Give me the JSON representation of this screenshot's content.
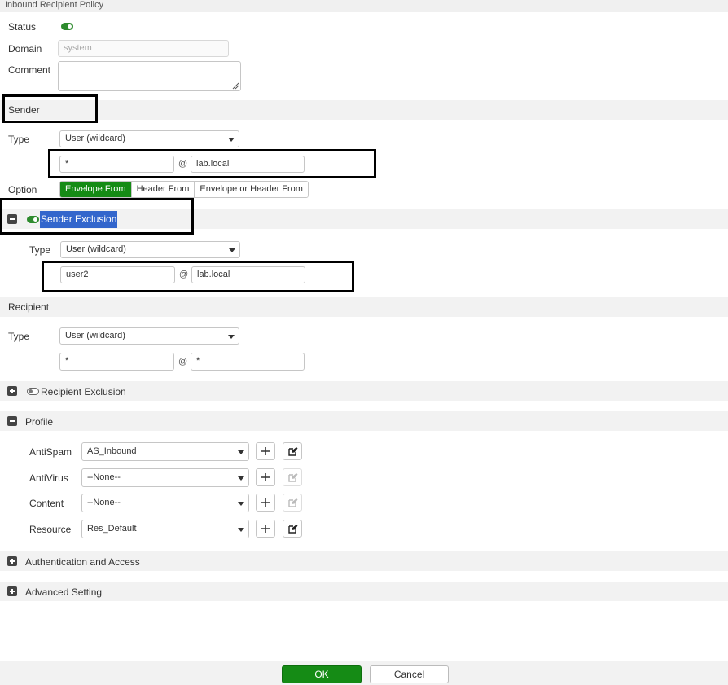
{
  "window": {
    "title": "Inbound Recipient Policy"
  },
  "general": {
    "status_label": "Status",
    "domain_label": "Domain",
    "domain_placeholder": "system",
    "comment_label": "Comment"
  },
  "sender": {
    "title": "Sender",
    "type_label": "Type",
    "type_value": "User (wildcard)",
    "user_value": "*",
    "at_sign": "@",
    "domain_value": "lab.local",
    "option_label": "Option",
    "options": [
      "Envelope From",
      "Header From",
      "Envelope or Header From"
    ],
    "selected_option": "Envelope From"
  },
  "sender_exclusion": {
    "title": "Sender Exclusion",
    "type_label": "Type",
    "type_value": "User (wildcard)",
    "user_value": "user2",
    "at_sign": "@",
    "domain_value": "lab.local"
  },
  "recipient": {
    "title": "Recipient",
    "type_label": "Type",
    "type_value": "User (wildcard)",
    "user_value": "*",
    "at_sign": "@",
    "domain_value": "*"
  },
  "recipient_exclusion": {
    "title": "Recipient Exclusion"
  },
  "profile": {
    "title": "Profile",
    "rows": [
      {
        "label": "AntiSpam",
        "value": "AS_Inbound",
        "edit_enabled": true
      },
      {
        "label": "AntiVirus",
        "value": "--None--",
        "edit_enabled": false
      },
      {
        "label": "Content",
        "value": "--None--",
        "edit_enabled": false
      },
      {
        "label": "Resource",
        "value": "Res_Default",
        "edit_enabled": true
      }
    ]
  },
  "authentication": {
    "title": "Authentication and Access"
  },
  "advanced": {
    "title": "Advanced Setting"
  },
  "footer": {
    "ok_label": "OK",
    "cancel_label": "Cancel"
  },
  "colors": {
    "accent_green": "#158b15",
    "highlight_blue": "#3366cc",
    "band_gray": "#f2f2f2"
  },
  "icons": {
    "add": "plus-icon",
    "edit": "edit-icon",
    "expand": "expand-icon",
    "collapse": "collapse-icon"
  }
}
